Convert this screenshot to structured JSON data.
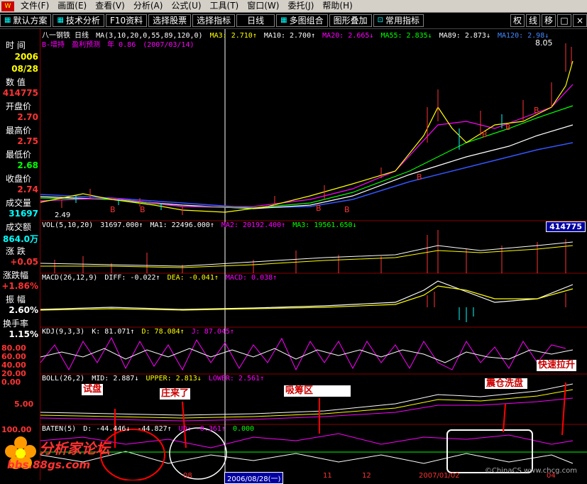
{
  "menu": {
    "logo": "W",
    "items": [
      "文件(F)",
      "画面(E)",
      "查看(V)",
      "分析(A)",
      "公式(U)",
      "工具(T)",
      "窗口(W)",
      "委托(J)",
      "帮助(H)"
    ]
  },
  "toolbar": {
    "buttons": [
      "默认方案",
      "技术分析",
      "F10资料",
      "选择股票",
      "选择指标",
      "日线",
      "多图组合",
      "图形叠加",
      "常用指标"
    ],
    "right": [
      "权",
      "线",
      "移",
      "□",
      "×"
    ]
  },
  "left": {
    "time_label": "时 间",
    "year": "2006",
    "date": "08/28",
    "num_label": "数 值",
    "num_val": "414775",
    "open_label": "开盘价",
    "open": "2.70",
    "high_label": "最高价",
    "high": "2.75",
    "low_label": "最低价",
    "low": "2.68",
    "close_label": "收盘价",
    "close": "2.74",
    "vol_label": "成交量",
    "vol": "31697",
    "amt_label": "成交额",
    "amt": "864.0万",
    "chg_label": "涨 跌",
    "chg": "+0.05",
    "pct_label": "涨跌幅",
    "pct": "+1.86%",
    "amp_label": "振 幅",
    "amp": "2.60%",
    "turn_label": "换手率",
    "turn": "1.15%"
  },
  "headers": {
    "main": [
      "八一钢铁 日线",
      "MA(3,10,20,0,55,89,120,0)",
      "MA3: 2.710↑",
      "MA10: 2.700↑",
      "MA20: 2.665↓",
      "MA55: 2.835↓",
      "MA89: 2.873↓",
      "MA120: 2.98↓"
    ],
    "main2": [
      "B-增持",
      "盈利预测",
      "年 0.86",
      "(2007/03/14)"
    ],
    "vol": [
      "VOL(5,10,20)",
      "31697.000↑",
      "MA1: 22496.000↑",
      "MA2: 20192.400↑",
      "MA3: 19561.650↓"
    ],
    "macd": [
      "MACD(26,12,9)",
      "DIFF: -0.022↑",
      "DEA: -0.041↑",
      "MACD: 0.038↑"
    ],
    "kdj": [
      "KDJ(9,3,3)",
      "K: 81.071↑",
      "D: 78.084↑",
      "J: 87.045↑"
    ],
    "boll": [
      "BOLL(26,2)",
      "MID: 2.887↓",
      "UPPER: 2.813↓",
      "LOWER: 2.561↑"
    ],
    "baten": [
      "BATEN(5)",
      "D: -44.446↓",
      "-44.827↑",
      "UD: -0.361↑",
      "0.000"
    ]
  },
  "price_tag": "8.05",
  "low_tag": "2.49",
  "vol_badge": "414775",
  "yaxis": {
    "kdj": [
      "80.00",
      "60.00",
      "40.00",
      "20.00",
      "0.00"
    ],
    "boll": "5.00",
    "baten": "100.00"
  },
  "annotations": [
    "试盘",
    "庄来了",
    "吸筹区",
    "震仓洗盘",
    "快速拉升"
  ],
  "date_tab": "2006/08/28(一)",
  "xticks": [
    "08",
    "11",
    "12",
    "2007/01/02",
    "03",
    "04"
  ],
  "watermark": {
    "title": "分析家论坛",
    "url": "bbs.88gs.com",
    "right": "©ChinaCS www.chcg.com"
  },
  "chart_data": {
    "type": "line",
    "title": "八一钢铁 日线",
    "note": "illustrative shape of price series (close) rising from ~2.5 to ~8",
    "series": [
      {
        "values": [
          2.9,
          2.8,
          2.7,
          2.75,
          2.6,
          2.55,
          2.5,
          2.6,
          2.65,
          2.7,
          2.8,
          2.9,
          3.0,
          3.1,
          3.5,
          4.0,
          5.0,
          5.6,
          4.8,
          5.0,
          5.4,
          5.2,
          5.6,
          6.0,
          6.5,
          7.5,
          8.05
        ]
      }
    ]
  }
}
